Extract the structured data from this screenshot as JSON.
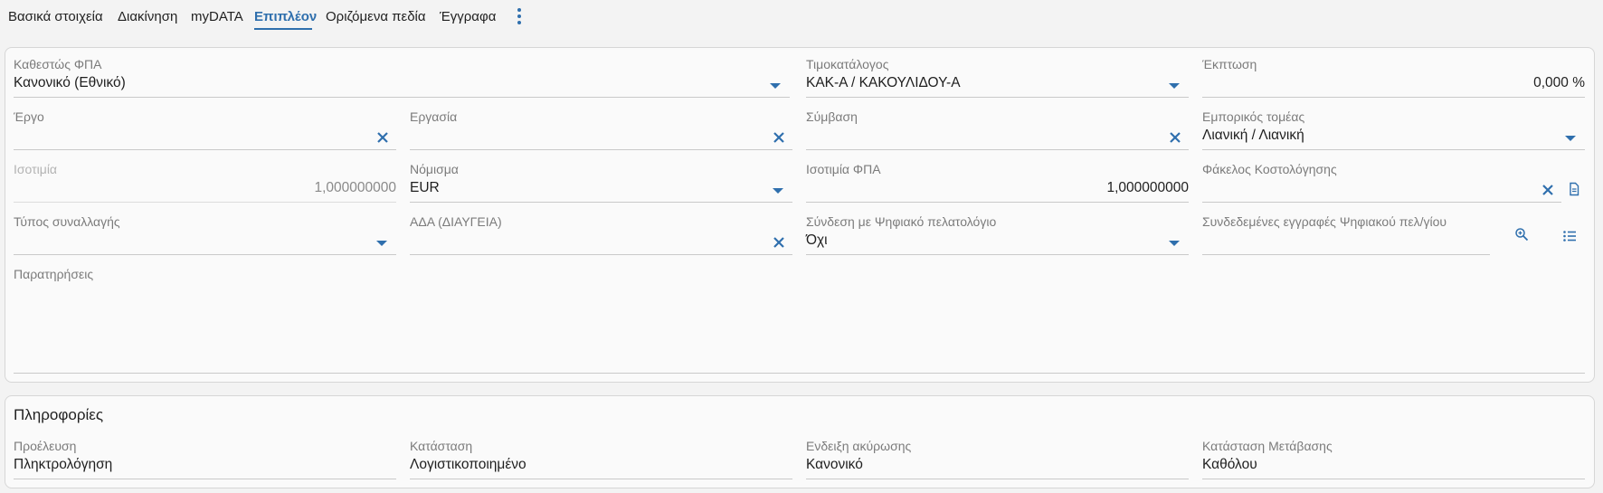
{
  "tabs": [
    {
      "label": "Βασικά στοιχεία"
    },
    {
      "label": "Διακίνηση"
    },
    {
      "label": "myDATA"
    },
    {
      "label": "Επιπλέον"
    },
    {
      "label": "Οριζόμενα πεδία"
    },
    {
      "label": "Έγγραφα"
    }
  ],
  "active_tab": "Επιπλέον",
  "accent_color": "#2f6fad",
  "fields": {
    "vat_status": {
      "label": "Καθεστώς ΦΠΑ",
      "value": "Κανονικό (Εθνικό)"
    },
    "price_list": {
      "label": "Τιμοκατάλογος",
      "value": "ΚΑΚ-Α / ΚΑΚΟΥΛΙΔΟΥ-Α"
    },
    "discount": {
      "label": "Έκπτωση",
      "value": "0,000 %"
    },
    "project": {
      "label": "Έργο",
      "value": ""
    },
    "task": {
      "label": "Εργασία",
      "value": ""
    },
    "contract": {
      "label": "Σύμβαση",
      "value": ""
    },
    "business_sector": {
      "label": "Εμπορικός τομέας",
      "value": "Λιανική / Λιανική"
    },
    "parity": {
      "label": "Ισοτιμία",
      "value": "1,000000000"
    },
    "currency": {
      "label": "Νόμισμα",
      "value": "EUR"
    },
    "vat_parity": {
      "label": "Ισοτιμία ΦΠΑ",
      "value": "1,000000000"
    },
    "costing_folder": {
      "label": "Φάκελος Κοστολόγησης",
      "value": ""
    },
    "transaction_type": {
      "label": "Τύπος συναλλαγής",
      "value": ""
    },
    "ada": {
      "label": "ΑΔΑ (ΔΙΑΥΓΕΙΑ)",
      "value": ""
    },
    "digital_link": {
      "label": "Σύνδεση με Ψηφιακό πελατολόγιο",
      "value": "Όχι"
    },
    "linked_records": {
      "label": "Συνδεδεμένες εγγραφές Ψηφιακού πελ/γίου",
      "value": ""
    },
    "notes": {
      "label": "Παρατηρήσεις",
      "value": ""
    }
  },
  "info": {
    "title": "Πληροφορίες",
    "origin": {
      "label": "Προέλευση",
      "value": "Πληκτρολόγηση"
    },
    "status": {
      "label": "Κατάσταση",
      "value": "Λογιστικοποιημένο"
    },
    "cancel_flag": {
      "label": "Ενδειξη ακύρωσης",
      "value": "Κανονικό"
    },
    "transfer_status": {
      "label": "Κατάσταση Μετάβασης",
      "value": "Καθόλου"
    }
  }
}
